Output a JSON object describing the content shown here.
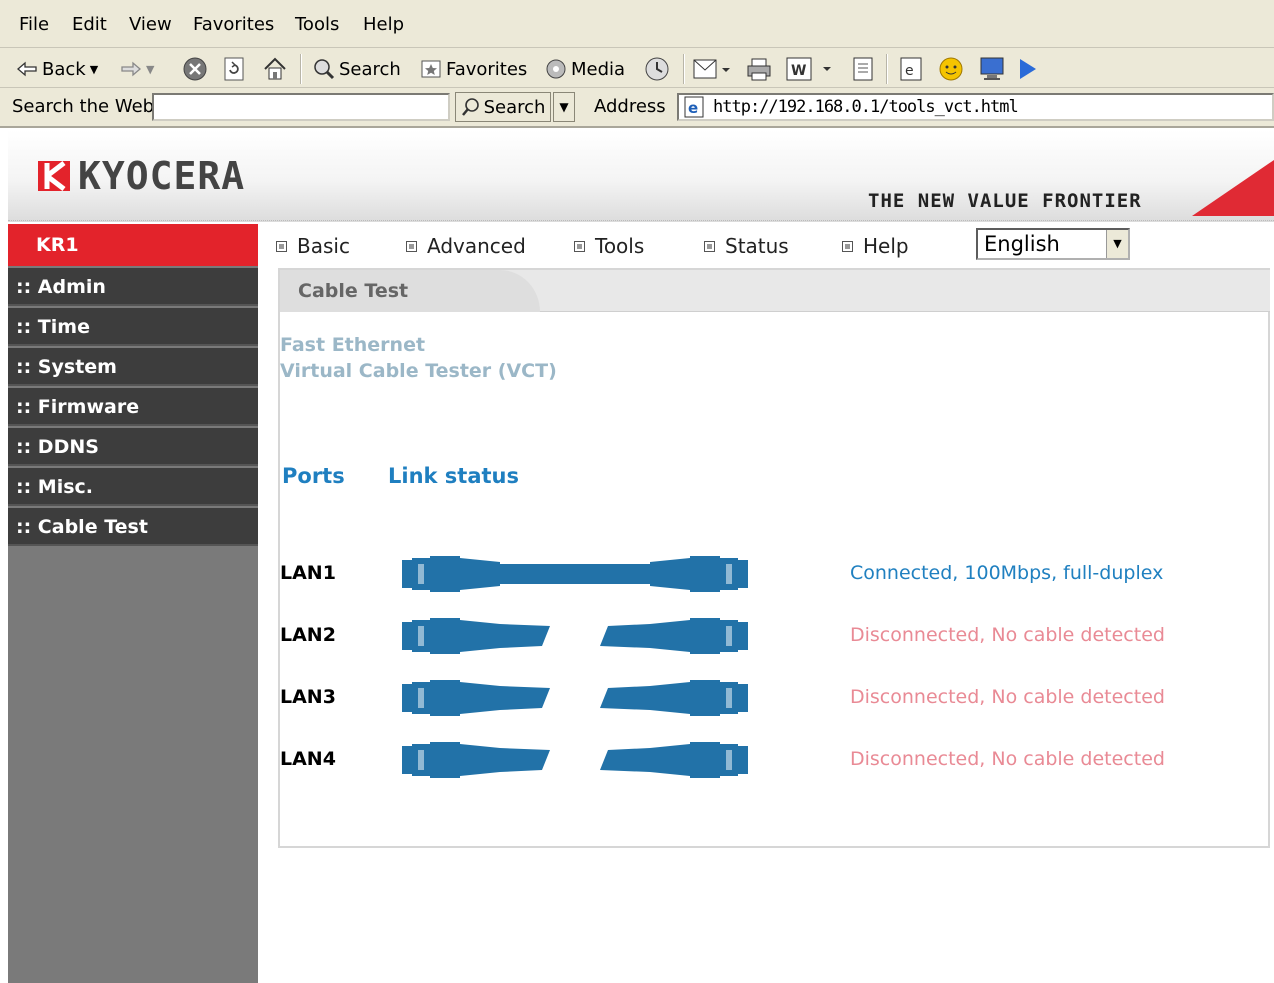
{
  "browser": {
    "menu": [
      "File",
      "Edit",
      "View",
      "Favorites",
      "Tools",
      "Help"
    ],
    "toolbar": {
      "back": "Back",
      "search": "Search",
      "favorites": "Favorites",
      "media": "Media"
    },
    "search_web_label": "Search the Web",
    "search_button": "Search",
    "address_label": "Address",
    "url": "http://192.168.0.1/tools_vct.html"
  },
  "header": {
    "logo": "KYOCERA",
    "slogan": "THE NEW VALUE FRONTIER"
  },
  "sidebar": {
    "model": "KR1",
    "items": [
      ":: Admin",
      ":: Time",
      ":: System",
      ":: Firmware",
      ":: DDNS",
      ":: Misc.",
      ":: Cable Test"
    ]
  },
  "nav": {
    "items": [
      "Basic",
      "Advanced",
      "Tools",
      "Status",
      "Help"
    ],
    "language": "English"
  },
  "panel": {
    "title": "Cable Test",
    "desc_line1": "Fast Ethernet",
    "desc_line2": "Virtual Cable Tester (VCT)",
    "col_ports": "Ports",
    "col_link": "Link status",
    "rows": [
      {
        "port": "LAN1",
        "status": "Connected, 100Mbps, full-duplex",
        "connected": true
      },
      {
        "port": "LAN2",
        "status": "Disconnected, No cable detected",
        "connected": false
      },
      {
        "port": "LAN3",
        "status": "Disconnected, No cable detected",
        "connected": false
      },
      {
        "port": "LAN4",
        "status": "Disconnected, No cable detected",
        "connected": false
      }
    ]
  },
  "colors": {
    "accent_red": "#e3232b",
    "link_blue": "#1f7fc0",
    "cable_blue": "#2272a8",
    "error_pink": "#e98a95"
  }
}
